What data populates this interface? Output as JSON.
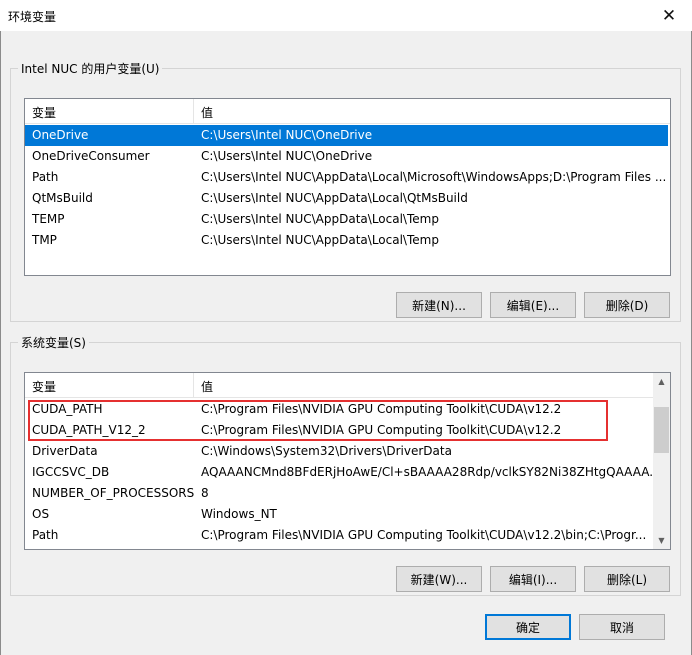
{
  "window": {
    "title": "环境变量",
    "close_glyph": "✕"
  },
  "user_group": {
    "legend": "Intel NUC 的用户变量(U)",
    "columns": [
      "变量",
      "值"
    ],
    "rows": [
      {
        "name": "OneDrive",
        "value": "C:\\Users\\Intel NUC\\OneDrive",
        "selected": true
      },
      {
        "name": "OneDriveConsumer",
        "value": "C:\\Users\\Intel NUC\\OneDrive"
      },
      {
        "name": "Path",
        "value": "C:\\Users\\Intel NUC\\AppData\\Local\\Microsoft\\WindowsApps;D:\\Program Files ..."
      },
      {
        "name": "QtMsBuild",
        "value": "C:\\Users\\Intel NUC\\AppData\\Local\\QtMsBuild"
      },
      {
        "name": "TEMP",
        "value": "C:\\Users\\Intel NUC\\AppData\\Local\\Temp"
      },
      {
        "name": "TMP",
        "value": "C:\\Users\\Intel NUC\\AppData\\Local\\Temp"
      }
    ],
    "buttons": {
      "new": "新建(N)...",
      "edit": "编辑(E)...",
      "delete": "删除(D)"
    }
  },
  "system_group": {
    "legend": "系统变量(S)",
    "columns": [
      "变量",
      "值"
    ],
    "rows": [
      {
        "name": "CUDA_PATH",
        "value": "C:\\Program Files\\NVIDIA GPU Computing Toolkit\\CUDA\\v12.2"
      },
      {
        "name": "CUDA_PATH_V12_2",
        "value": "C:\\Program Files\\NVIDIA GPU Computing Toolkit\\CUDA\\v12.2"
      },
      {
        "name": "DriverData",
        "value": "C:\\Windows\\System32\\Drivers\\DriverData"
      },
      {
        "name": "IGCCSVC_DB",
        "value": "AQAAANCMnd8BFdERjHoAwE/Cl+sBAAAA28Rdp/vclkSY82Ni38ZHtgQAAAA..."
      },
      {
        "name": "NUMBER_OF_PROCESSORS",
        "value": "8"
      },
      {
        "name": "OS",
        "value": "Windows_NT"
      },
      {
        "name": "Path",
        "value": "C:\\Program Files\\NVIDIA GPU Computing Toolkit\\CUDA\\v12.2\\bin;C:\\Progr..."
      }
    ],
    "buttons": {
      "new": "新建(W)...",
      "edit": "编辑(I)...",
      "delete": "删除(L)"
    },
    "scrollbar": {
      "up_glyph": "▲",
      "down_glyph": "▼"
    }
  },
  "dialog_buttons": {
    "ok": "确定",
    "cancel": "取消"
  },
  "colors": {
    "selection": "#0078d7",
    "annotation_box": "#e53030"
  }
}
